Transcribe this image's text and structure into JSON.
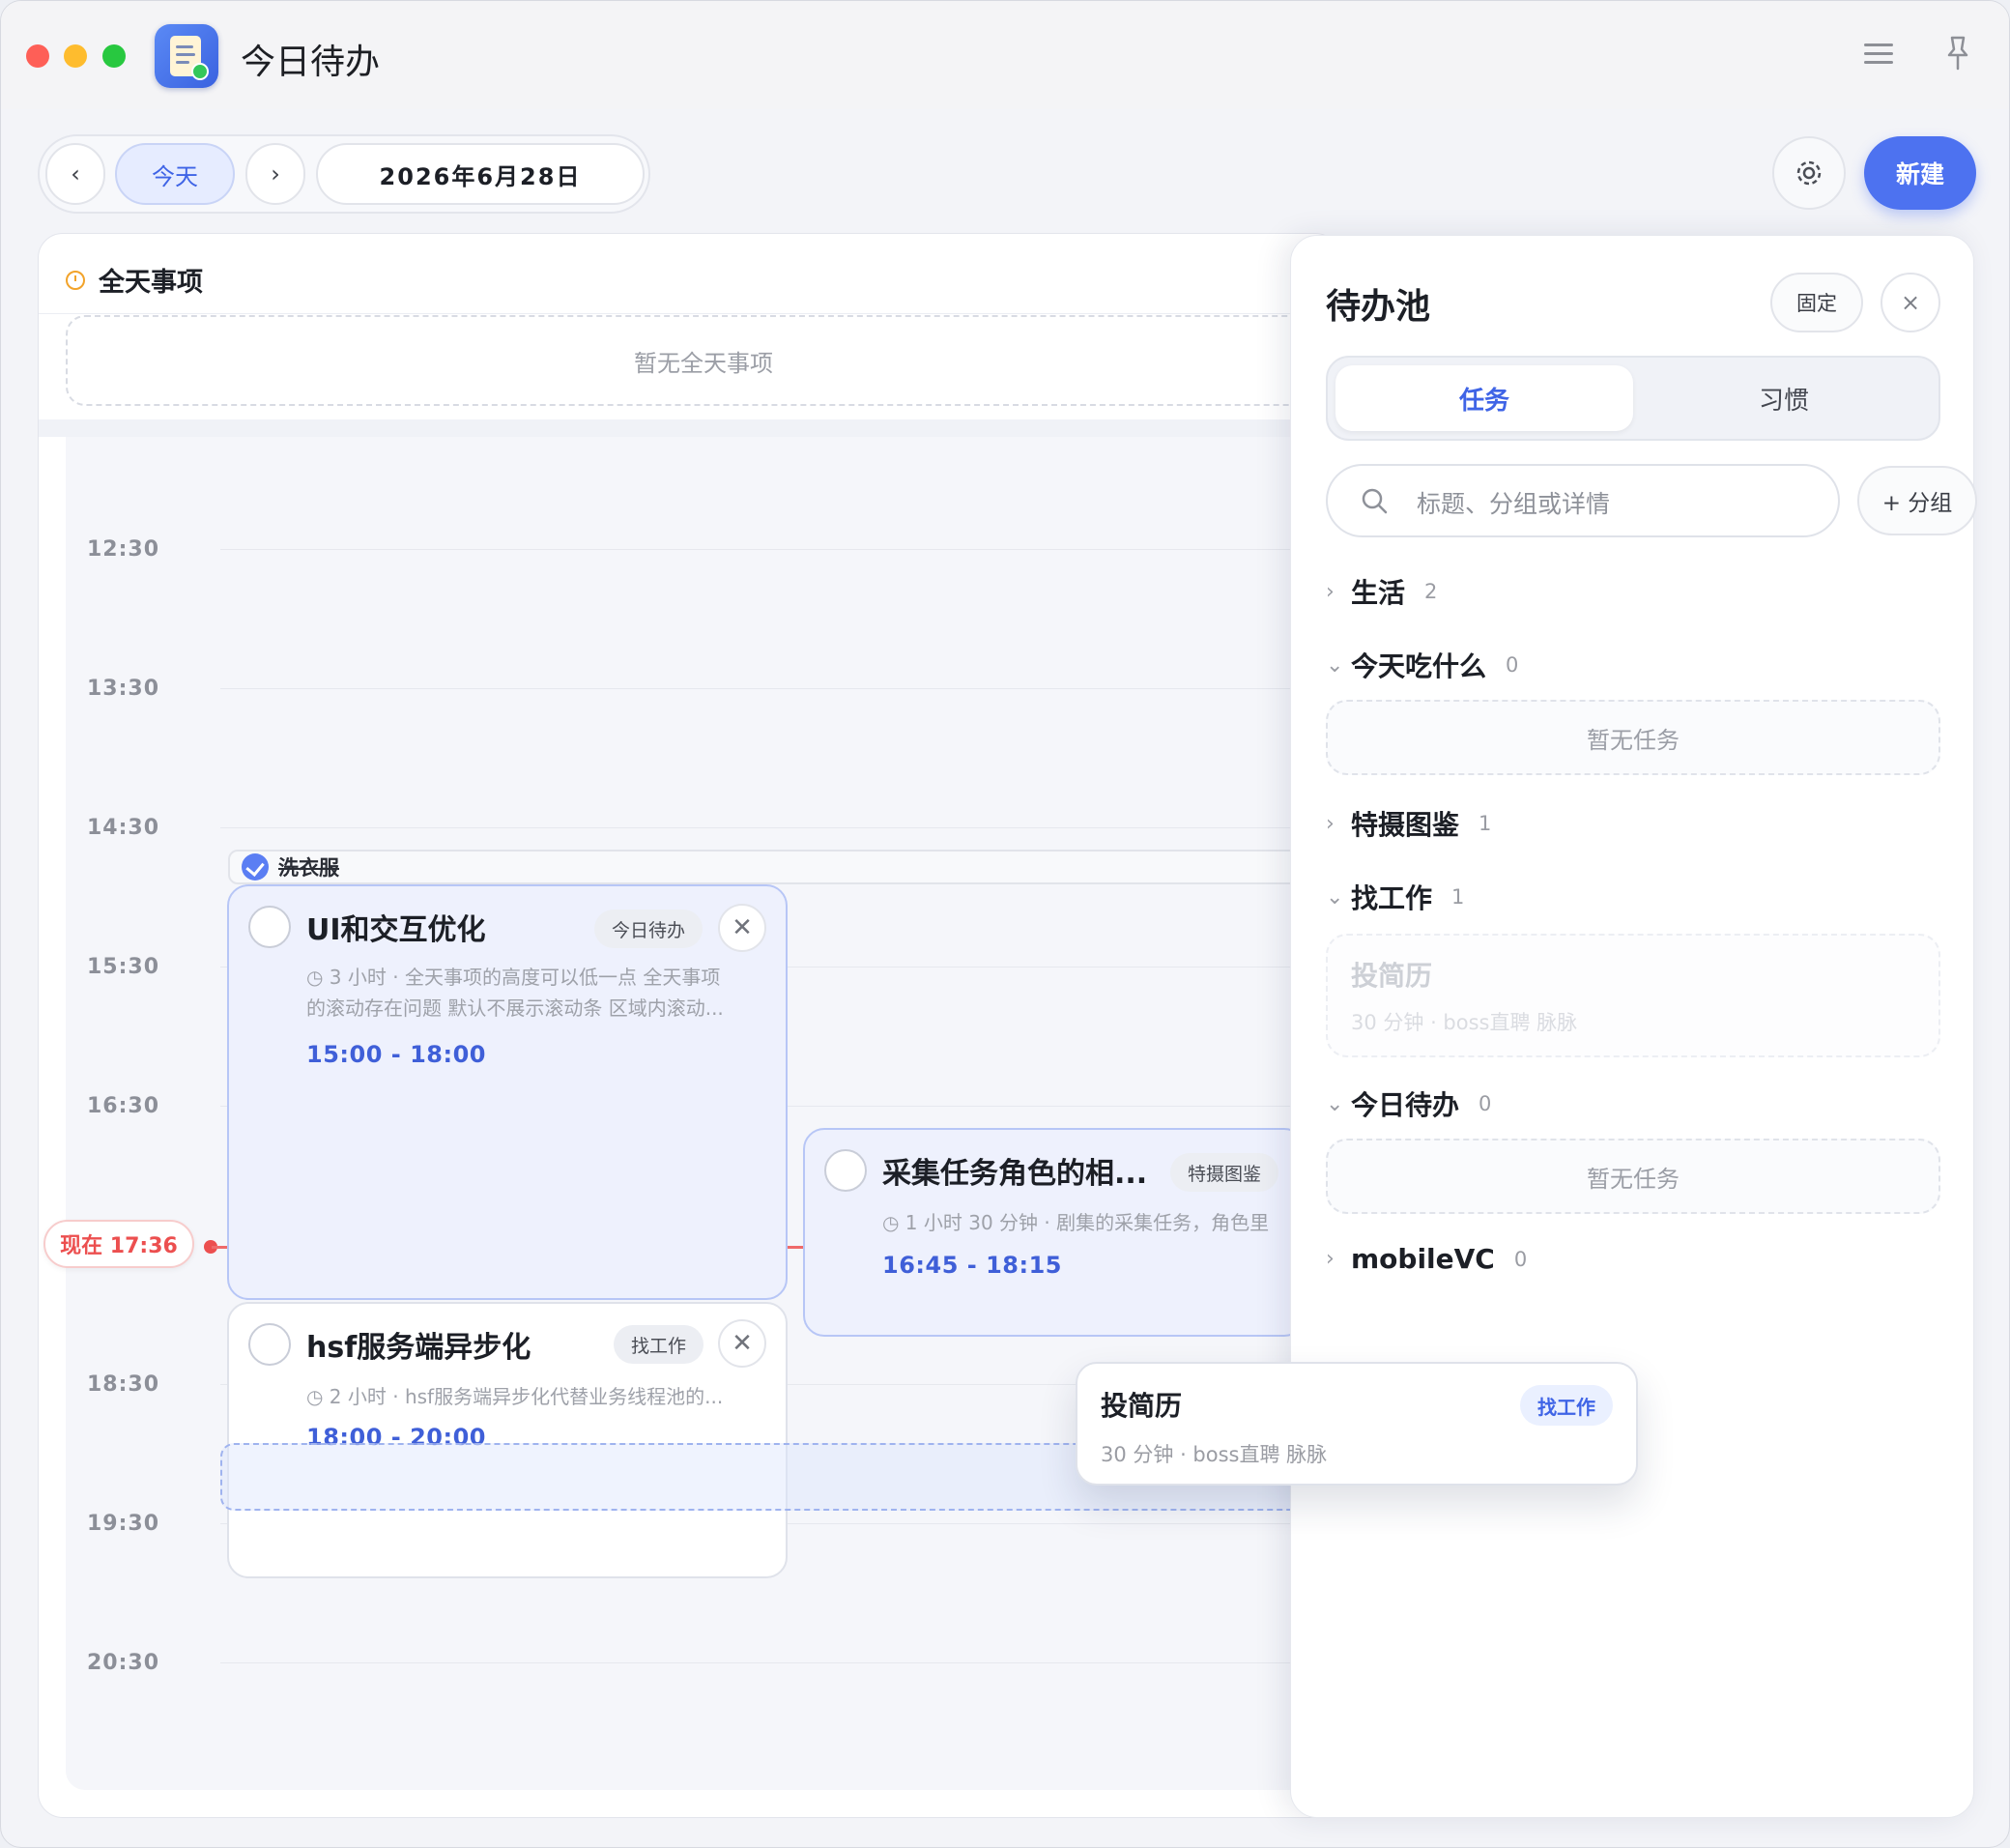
{
  "app": {
    "title": "今日待办"
  },
  "toolbar": {
    "prev": "‹",
    "today": "今天",
    "next": "›",
    "date": "2026年6月28日",
    "new": "新建",
    "settings_icon": "gear-icon"
  },
  "calendar": {
    "allday_title": "全天事项",
    "allday_empty": "暂无全天事项",
    "time_labels": [
      "12:30",
      "13:30",
      "14:30",
      "15:30",
      "16:30",
      "18:30",
      "19:30",
      "20:30"
    ],
    "now_label": "现在 17:36",
    "completed_event": "洗衣服",
    "events": [
      {
        "title": "UI和交互优化",
        "tag": "今日待办",
        "desc_line1": "◷ 3 小时 · 全天事项的高度可以低一点 全天事项",
        "desc_line2": "的滚动存在问题 默认不展示滚动条 区域内滚动...",
        "time": "15:00 - 18:00"
      },
      {
        "title": "采集任务角色的相...",
        "tag": "特摄图鉴",
        "desc_line1": "◷ 1 小时 30 分钟 · 剧集的采集任务，角色里",
        "time": "16:45 - 18:15"
      },
      {
        "title": "hsf服务端异步化",
        "tag": "找工作",
        "desc_line1": "◷ 2 小时 · hsf服务端异步化代替业务线程池的...",
        "time": "18:00 - 20:00"
      }
    ]
  },
  "pool": {
    "title": "待办池",
    "pin": "固定",
    "close": "×",
    "tabs": [
      "任务",
      "习惯"
    ],
    "search_placeholder": "标题、分组或详情",
    "add_group": "+ 分组",
    "groups": [
      {
        "name": "生活",
        "count": "2",
        "chevron": "›"
      },
      {
        "name": "今天吃什么",
        "count": "0",
        "chevron": "⌄"
      },
      {
        "name": "特摄图鉴",
        "count": "1",
        "chevron": "›"
      },
      {
        "name": "找工作",
        "count": "1",
        "chevron": "⌄"
      },
      {
        "name": "今日待办",
        "count": "0",
        "chevron": "⌄"
      },
      {
        "name": "mobileVC",
        "count": "0",
        "chevron": "›"
      }
    ],
    "empty_text": "暂无任务",
    "ghost_task": {
      "title": "投简历",
      "sub": "30 分钟 · boss直聘 脉脉"
    }
  },
  "drag_card": {
    "title": "投简历",
    "sub": "30 分钟 · boss直聘 脉脉",
    "tag": "找工作"
  }
}
